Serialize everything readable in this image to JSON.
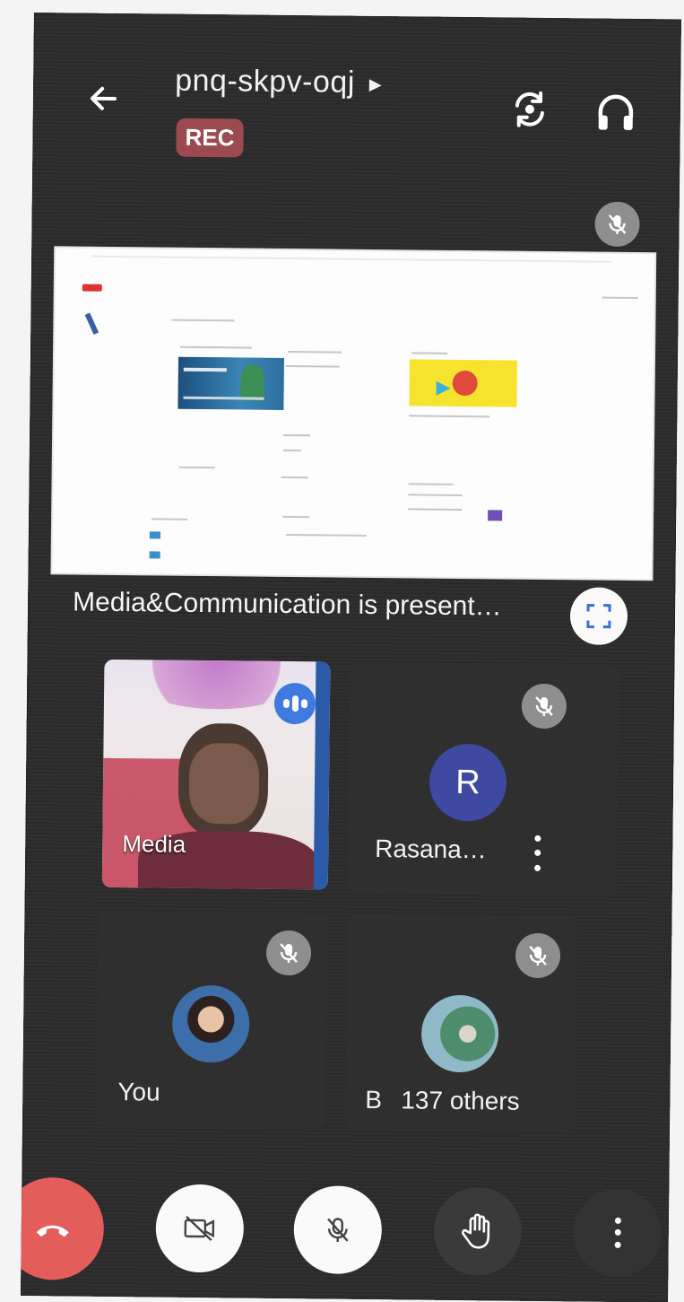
{
  "header": {
    "meeting_code": "pnq-skpv-oqj",
    "rec_badge": "REC"
  },
  "presentation": {
    "label": "Media&Communication is present…"
  },
  "participants": [
    {
      "name": "Media",
      "speaking": true
    },
    {
      "name": "Rasana…",
      "initial": "R",
      "avatar_color": "#3e49a2",
      "muted": true
    },
    {
      "name": "You",
      "muted": true
    },
    {
      "name": "B",
      "others_label": "137 others",
      "muted": true
    }
  ],
  "controls": {
    "end_call_color": "#e35d5b"
  },
  "colors": {
    "background": "#2b2b2b",
    "rec_badge": "#9c4a4f",
    "speaking_indicator": "#3f7ae0"
  }
}
